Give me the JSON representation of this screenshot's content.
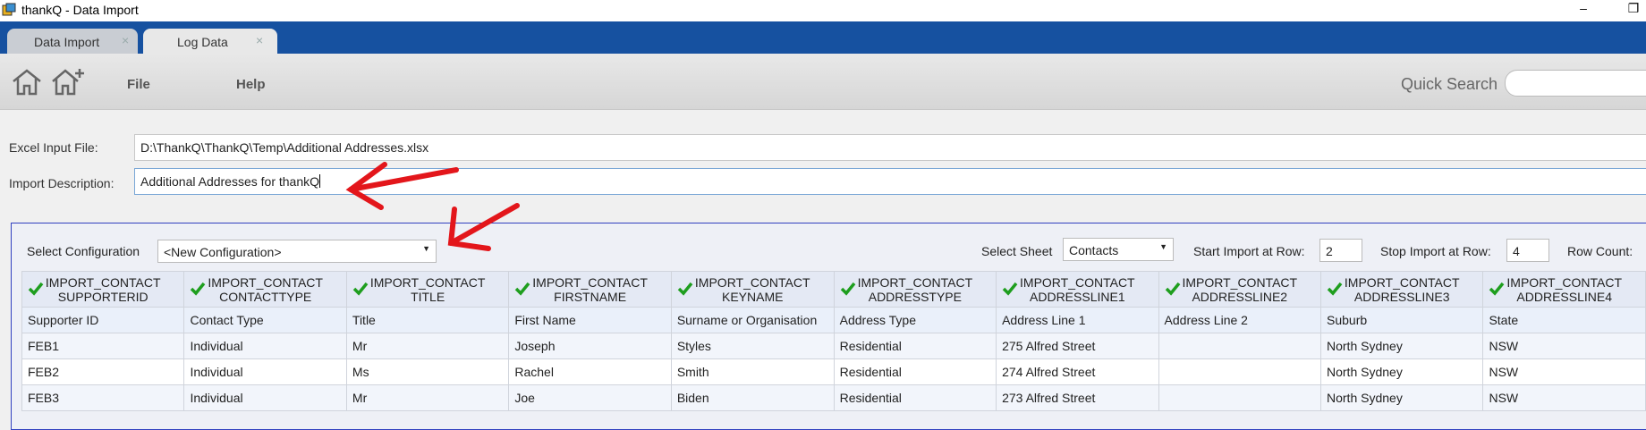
{
  "window": {
    "title": "thankQ - Data Import",
    "minimize": "–",
    "restore": "❐"
  },
  "tabs": [
    {
      "label": "Data Import",
      "close": "×"
    },
    {
      "label": "Log Data",
      "close": "×"
    }
  ],
  "ribbon": {
    "home_icon": "home-icon",
    "add_home_icon": "home-add-icon",
    "menu_file": "File",
    "menu_help": "Help",
    "quick_search_label": "Quick Search",
    "quick_search_value": ""
  },
  "form": {
    "excel_label": "Excel Input File:",
    "excel_value": "D:\\ThankQ\\ThankQ\\Temp\\Additional Addresses.xlsx",
    "description_label": "Import Description:",
    "description_value": "Additional Addresses for thankQ"
  },
  "config": {
    "select_config_label": "Select Configuration",
    "select_config_value": "<New Configuration>",
    "select_sheet_label": "Select Sheet",
    "select_sheet_value": "Contacts",
    "start_row_label": "Start Import at Row:",
    "start_row_value": "2",
    "stop_row_label": "Stop Import at Row:",
    "stop_row_value": "4",
    "row_count_label": "Row Count:"
  },
  "grid": {
    "mappings": [
      [
        "IMPORT_CONTACT",
        "SUPPORTERID"
      ],
      [
        "IMPORT_CONTACT",
        "CONTACTTYPE"
      ],
      [
        "IMPORT_CONTACT",
        "TITLE"
      ],
      [
        "IMPORT_CONTACT",
        "FIRSTNAME"
      ],
      [
        "IMPORT_CONTACT",
        "KEYNAME"
      ],
      [
        "IMPORT_CONTACT",
        "ADDRESSTYPE"
      ],
      [
        "IMPORT_CONTACT",
        "ADDRESSLINE1"
      ],
      [
        "IMPORT_CONTACT",
        "ADDRESSLINE2"
      ],
      [
        "IMPORT_CONTACT",
        "ADDRESSLINE3"
      ],
      [
        "IMPORT_CONTACT",
        "ADDRESSLINE4"
      ]
    ],
    "headers": [
      "Supporter ID",
      "Contact Type",
      "Title",
      "First Name",
      "Surname or Organisation",
      "Address Type",
      "Address Line 1",
      "Address Line 2",
      "Suburb",
      "State"
    ],
    "rows": [
      [
        "FEB1",
        "Individual",
        "Mr",
        "Joseph",
        "Styles",
        "Residential",
        "275 Alfred Street",
        "",
        "North Sydney",
        "NSW"
      ],
      [
        "FEB2",
        "Individual",
        "Ms",
        "Rachel",
        "Smith",
        "Residential",
        "274 Alfred Street",
        "",
        "North Sydney",
        "NSW"
      ],
      [
        "FEB3",
        "Individual",
        "Mr",
        "Joe",
        "Biden",
        "Residential",
        "273 Alfred Street",
        "",
        "North Sydney",
        "NSW"
      ]
    ]
  },
  "colors": {
    "tab_strip": "#1651a0",
    "check_green": "#1e9e1e",
    "annotation_red": "#e3161b"
  }
}
